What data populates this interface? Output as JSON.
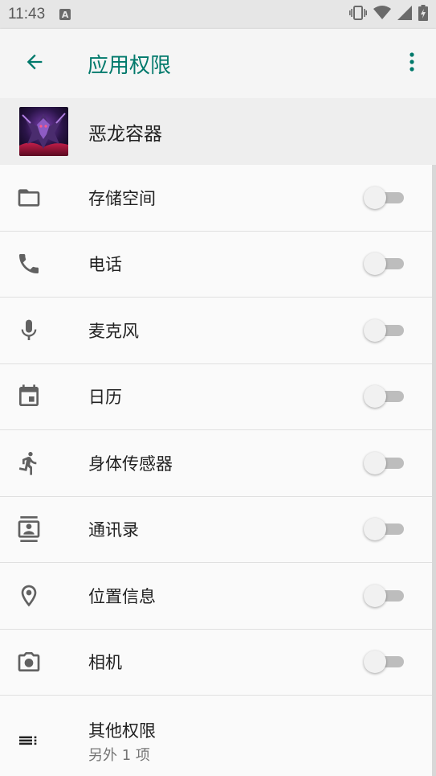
{
  "status_bar": {
    "time": "11:43",
    "notification_badge": "A",
    "icons": [
      "vibrate-icon",
      "wifi-icon",
      "signal-icon",
      "battery-charging-icon"
    ]
  },
  "app_bar": {
    "title": "应用权限",
    "back_icon": "arrow-back-icon",
    "menu_icon": "more-vert-icon",
    "accent_color": "#00796b"
  },
  "app": {
    "name": "恶龙容器"
  },
  "permissions": [
    {
      "label": "存储空间",
      "icon": "folder-icon",
      "enabled": false
    },
    {
      "label": "电话",
      "icon": "phone-icon",
      "enabled": false
    },
    {
      "label": "麦克风",
      "icon": "mic-icon",
      "enabled": false
    },
    {
      "label": "日历",
      "icon": "calendar-icon",
      "enabled": false
    },
    {
      "label": "身体传感器",
      "icon": "run-icon",
      "enabled": false
    },
    {
      "label": "通讯录",
      "icon": "contacts-icon",
      "enabled": false
    },
    {
      "label": "位置信息",
      "icon": "location-icon",
      "enabled": false
    },
    {
      "label": "相机",
      "icon": "camera-icon",
      "enabled": false
    }
  ],
  "other": {
    "label": "其他权限",
    "sub": "另外 1 项",
    "icon": "list-icon"
  }
}
